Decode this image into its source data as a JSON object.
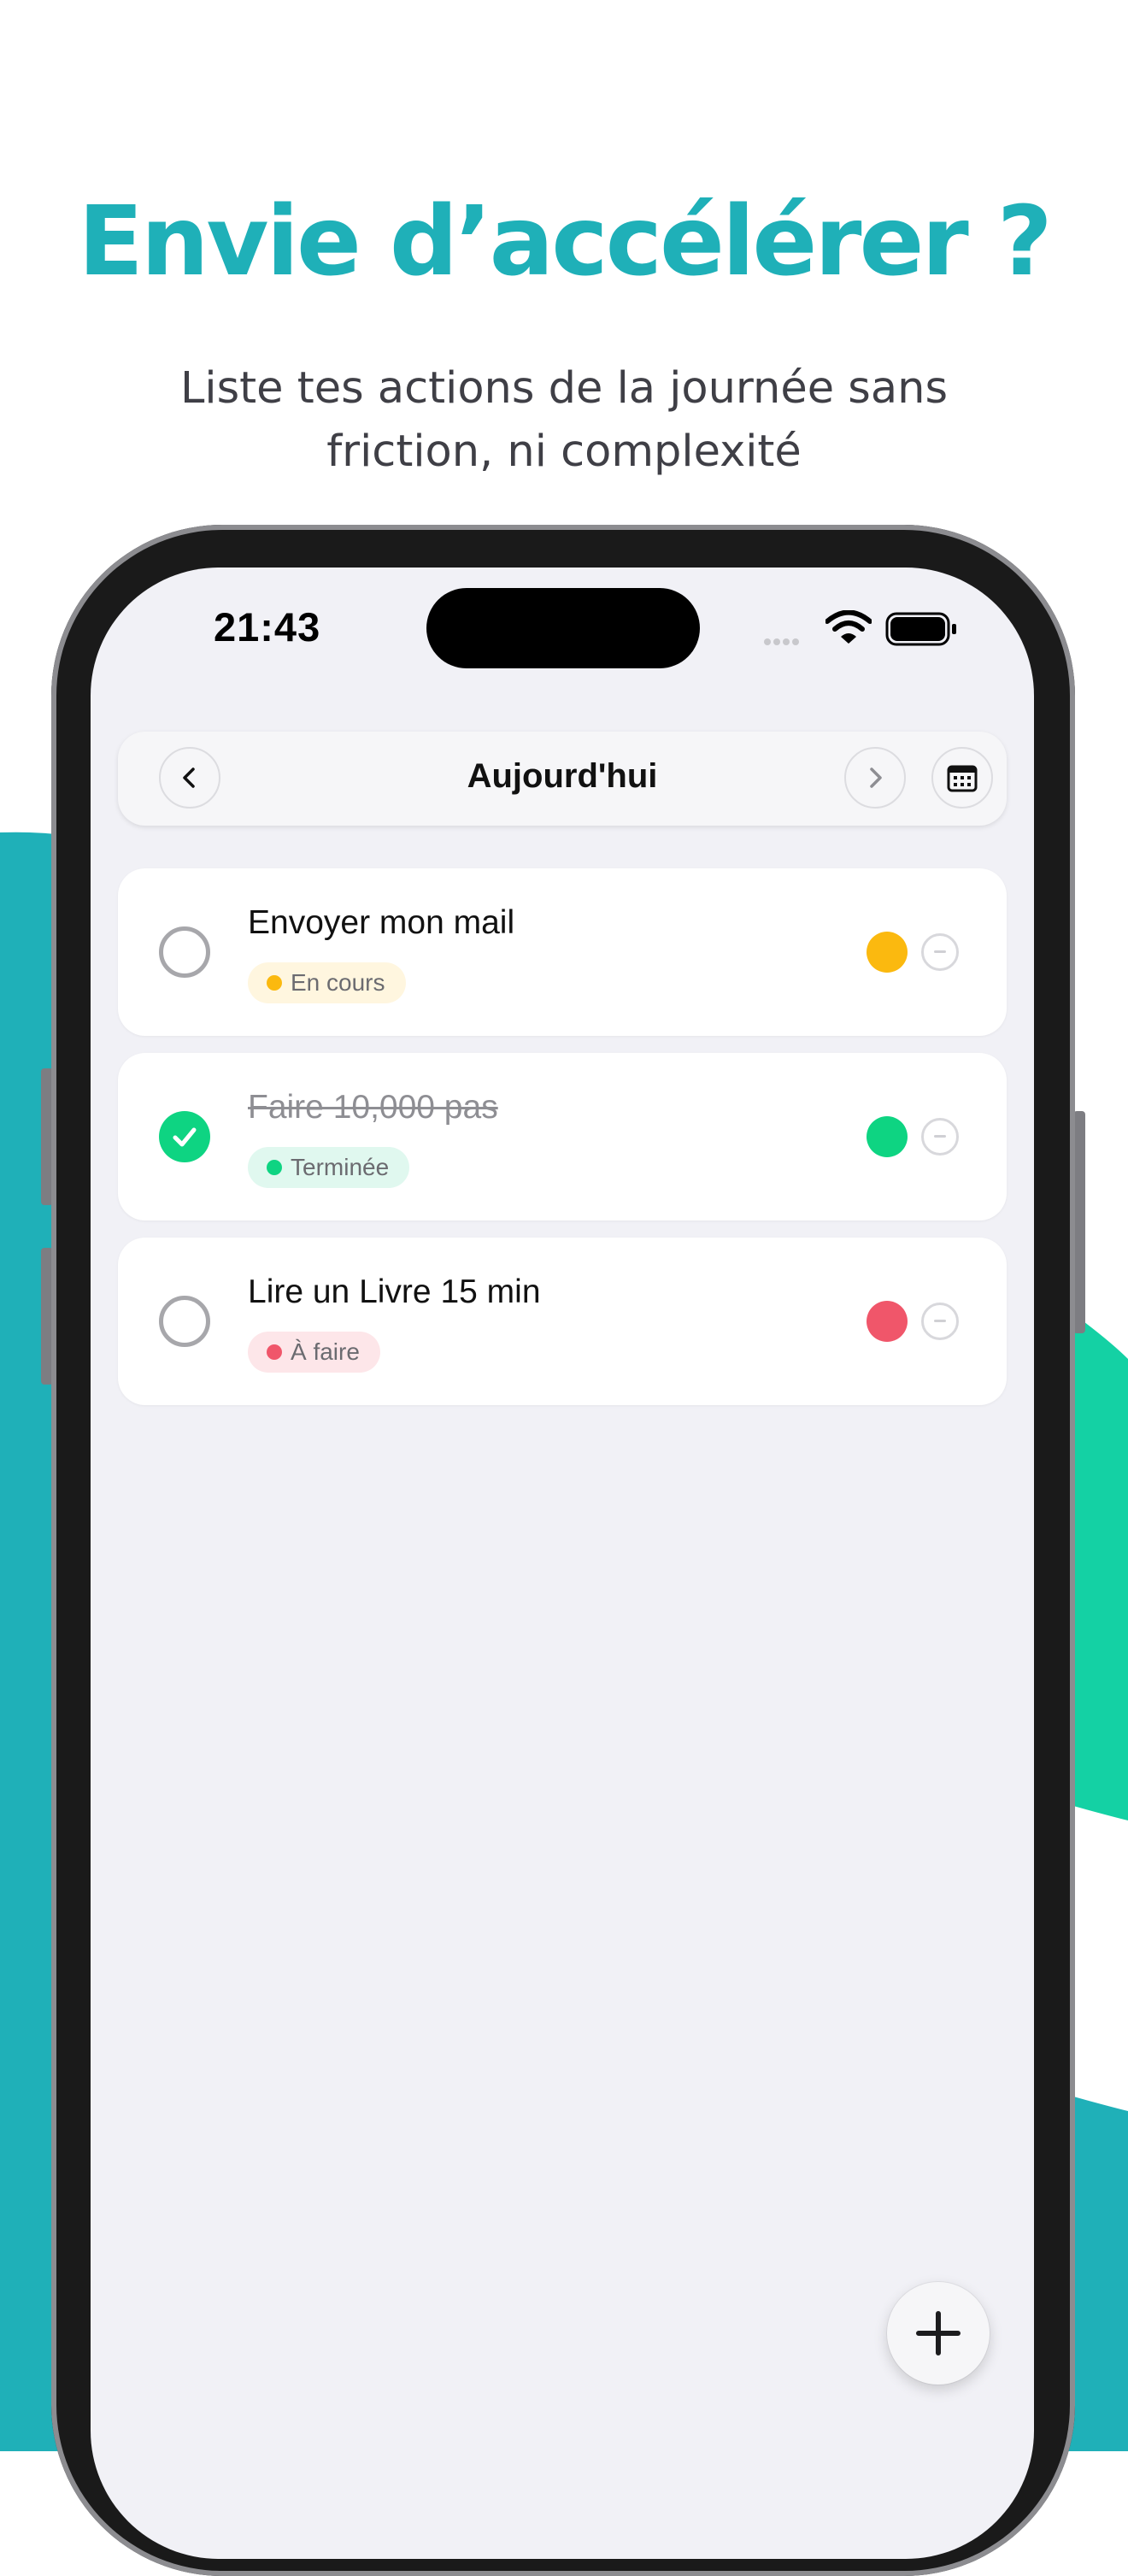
{
  "headline": "Envie d’accélérer ?",
  "subline": "Liste tes actions de la journée sans friction, ni complexité",
  "colors": {
    "brand_teal": "#1fb0b8",
    "brand_green": "#14d1a4",
    "in_progress": "#fbb90f",
    "done": "#0ed482",
    "todo": "#f0566a"
  },
  "status_bar": {
    "time": "21:43",
    "icons": [
      "signal-icon",
      "wifi-icon",
      "battery-icon"
    ]
  },
  "nav": {
    "title": "Aujourd'hui",
    "icons": [
      "chevron-left-icon",
      "chevron-right-icon",
      "calendar-icon"
    ]
  },
  "tasks": [
    {
      "title": "Envoyer mon mail",
      "status": "En cours",
      "completed": false,
      "color": "#fbb90f",
      "badge_bg": "#fff6df"
    },
    {
      "title": "Faire 10,000 pas",
      "status": "Terminée",
      "completed": true,
      "color": "#0ed482",
      "badge_bg": "#e0f8ef"
    },
    {
      "title": "Lire un Livre 15 min",
      "status": "À faire",
      "completed": false,
      "color": "#f0566a",
      "badge_bg": "#fde6e9"
    }
  ],
  "fab": {
    "icon": "plus-icon"
  }
}
